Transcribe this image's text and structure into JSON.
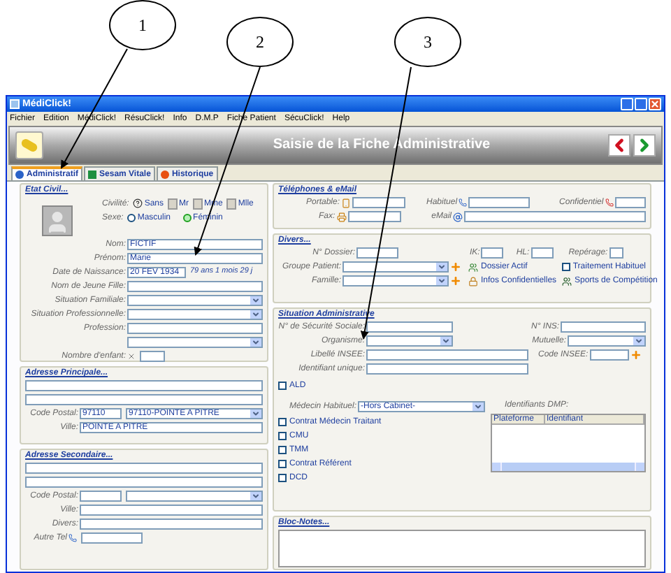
{
  "callouts": [
    "1",
    "2",
    "3"
  ],
  "window": {
    "title": "MédiClick!"
  },
  "menu": [
    "Fichier",
    "Edition",
    "MédiClick!",
    "RésuClick!",
    "Info",
    "D.M.P",
    "Fiche Patient",
    "SécuClick!",
    "Help"
  ],
  "header": {
    "title": "Saisie de la Fiche Administrative"
  },
  "tabs": [
    {
      "label": "Administratif",
      "selected": true
    },
    {
      "label": "Sesam Vitale",
      "selected": false
    },
    {
      "label": "Historique",
      "selected": false
    }
  ],
  "etat_civil": {
    "title": "Etat Civil...",
    "civilite": {
      "label": "Civilité:",
      "options": [
        "Sans",
        "Mr",
        "Mme",
        "Mlle"
      ]
    },
    "sexe": {
      "label": "Sexe:",
      "options": [
        {
          "label": "Masculin",
          "selected": false
        },
        {
          "label": "Féminin",
          "selected": true
        }
      ]
    },
    "fields": [
      {
        "label": "Nom:",
        "value": "FICTIF",
        "kind": "text"
      },
      {
        "label": "Prénom:",
        "value": "Marie",
        "kind": "text"
      },
      {
        "label": "Date de Naissance:",
        "value": "20 FEV 1934",
        "note": "79 ans 1 mois 29 j",
        "kind": "date"
      },
      {
        "label": "Nom de Jeune Fille:",
        "kind": "text"
      },
      {
        "label": "Situation Familiale:",
        "kind": "select"
      },
      {
        "label": "Situation Professionnelle:",
        "kind": "select"
      },
      {
        "label": "Profession:",
        "kind": "text"
      },
      {
        "kind": "select"
      },
      {
        "label": "Nombre d'enfant:",
        "kind": "count"
      }
    ]
  },
  "adresse_principale": {
    "title": "Adresse Principale...",
    "code_postal_label": "Code Postal:",
    "code_postal": "97110",
    "commune": "97110-POINTE A PITRE",
    "ville_label": "Ville:",
    "ville": "POINTE A PITRE"
  },
  "adresse_secondaire": {
    "title": "Adresse Secondaire...",
    "code_postal_label": "Code Postal:",
    "ville_label": "Ville:",
    "divers_label": "Divers:",
    "autre_tel_label": "Autre Tel"
  },
  "telephones": {
    "title": "Téléphones & eMail",
    "portable": "Portable:",
    "habituel": "Habituel",
    "confidentiel": "Confidentiel",
    "fax": "Fax:",
    "email": "eMail"
  },
  "divers": {
    "title": "Divers...",
    "dossier": "N° Dossier:",
    "ik": "IK:",
    "hl": "HL:",
    "reperage": "Repérage:",
    "groupe": "Groupe Patient:",
    "famille": "Famille:",
    "actions": [
      {
        "label": "Dossier Actif",
        "kind": "link"
      },
      {
        "label": "Traitement Habituel",
        "kind": "checkbox",
        "checked": false
      },
      {
        "label": "Infos Confidentielles",
        "kind": "link"
      },
      {
        "label": "Sports de Compétition",
        "kind": "link"
      }
    ]
  },
  "situation": {
    "title": "Situation Administrative",
    "secu": "N° de Sécurité Sociale:",
    "ins": "N° INS:",
    "organisme": "Organisme:",
    "mutuelle": "Mutuelle:",
    "libelle_insee": "Libellé INSEE:",
    "code_insee": "Code INSEE:",
    "identifiant": "Identifiant unique:",
    "ald": {
      "label": "ALD",
      "checked": false
    },
    "medecin_label": "Médecin Habituel:",
    "medecin": "-Hors Cabinet-",
    "dmp_label": "Identifiants DMP:",
    "dmp_columns": [
      "Plateforme",
      "Identifiant"
    ],
    "checkboxes": [
      {
        "label": "Contrat Médecin Traitant",
        "checked": false
      },
      {
        "label": "CMU",
        "checked": false
      },
      {
        "label": "TMM",
        "checked": false
      },
      {
        "label": "Contrat Référent",
        "checked": false
      },
      {
        "label": "DCD",
        "checked": false
      }
    ]
  },
  "notes": {
    "title": "Bloc-Notes..."
  }
}
